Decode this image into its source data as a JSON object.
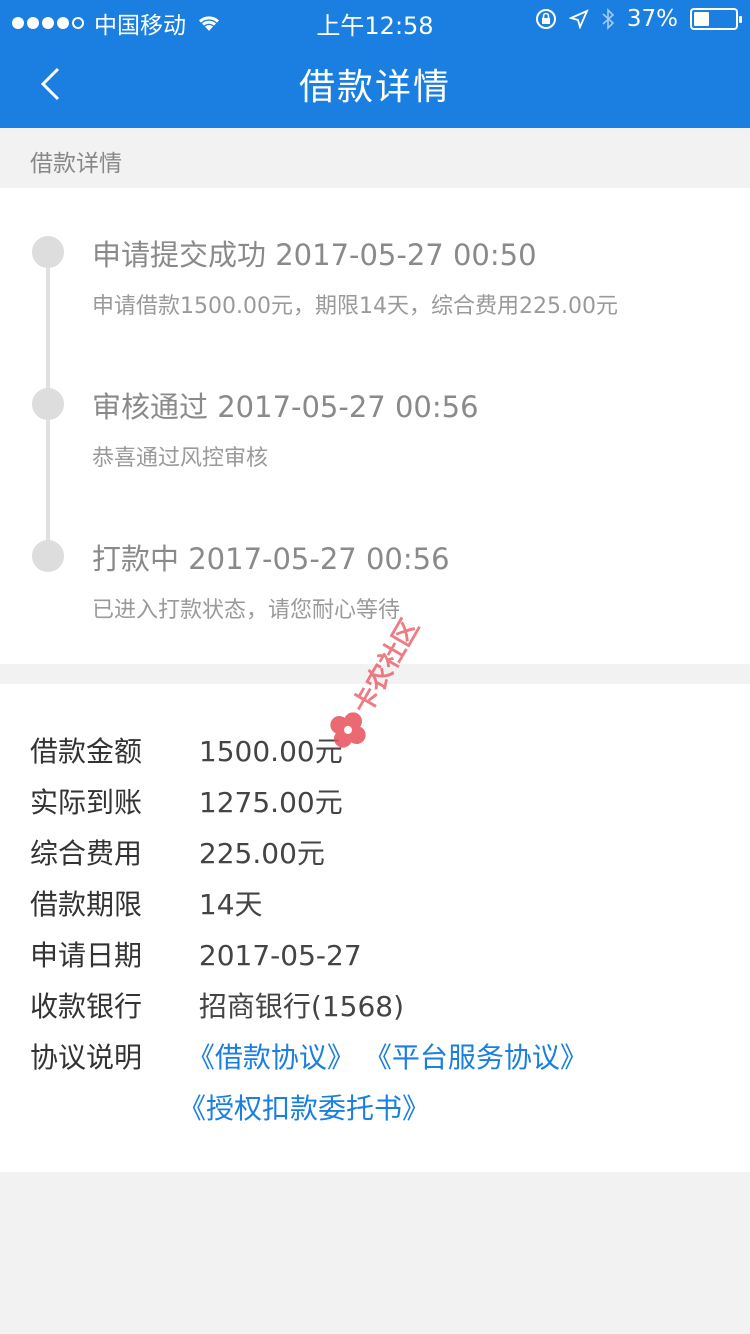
{
  "status_bar": {
    "carrier": "中国移动",
    "time": "上午12:58",
    "battery": "37%"
  },
  "nav": {
    "title": "借款详情"
  },
  "section_header": "借款详情",
  "timeline": [
    {
      "title": "申请提交成功 2017-05-27 00:50",
      "desc": "申请借款1500.00元，期限14天，综合费用225.00元"
    },
    {
      "title": "审核通过 2017-05-27 00:56",
      "desc": "恭喜通过风控审核"
    },
    {
      "title": "打款中 2017-05-27 00:56",
      "desc": "已进入打款状态，请您耐心等待"
    }
  ],
  "details": [
    {
      "label": "借款金额",
      "value": "1500.00元"
    },
    {
      "label": "实际到账",
      "value": "1275.00元"
    },
    {
      "label": "综合费用",
      "value": "225.00元"
    },
    {
      "label": "借款期限",
      "value": "14天"
    },
    {
      "label": "申请日期",
      "value": "2017-05-27"
    },
    {
      "label": "收款银行",
      "value": "招商银行(1568)"
    }
  ],
  "agreements": {
    "label": "协议说明",
    "links": [
      "《借款协议》",
      "《平台服务协议》",
      "《授权扣款委托书》"
    ]
  },
  "watermark_text": "卡农社区",
  "colors": {
    "accent": "#1a7fe0",
    "background": "#f2f2f2",
    "timeline_dot": "#dddddd"
  }
}
